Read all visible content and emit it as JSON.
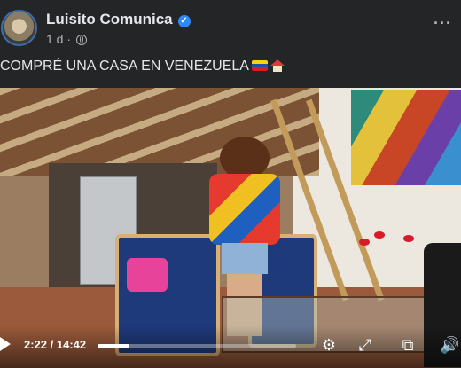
{
  "post": {
    "author": "Luisito Comunica",
    "verified_mark": "✓",
    "time": "1 d",
    "separator": "·",
    "privacy_icon": "globe-icon",
    "more_label": "···",
    "text": "COMPRÉ UNA CASA EN VENEZUELA"
  },
  "video": {
    "current_time": "2:22",
    "duration": "14:42",
    "time_display": "2:22 / 14:42",
    "progress_fraction": 0.161,
    "icons": [
      "play-icon",
      "settings-icon",
      "fullscreen-icon",
      "picture-in-picture-icon",
      "volume-icon"
    ]
  },
  "colors": {
    "background": "#242526",
    "text": "#e4e6eb",
    "secondary_text": "#b0b3b8",
    "verified": "#2d88ff"
  }
}
